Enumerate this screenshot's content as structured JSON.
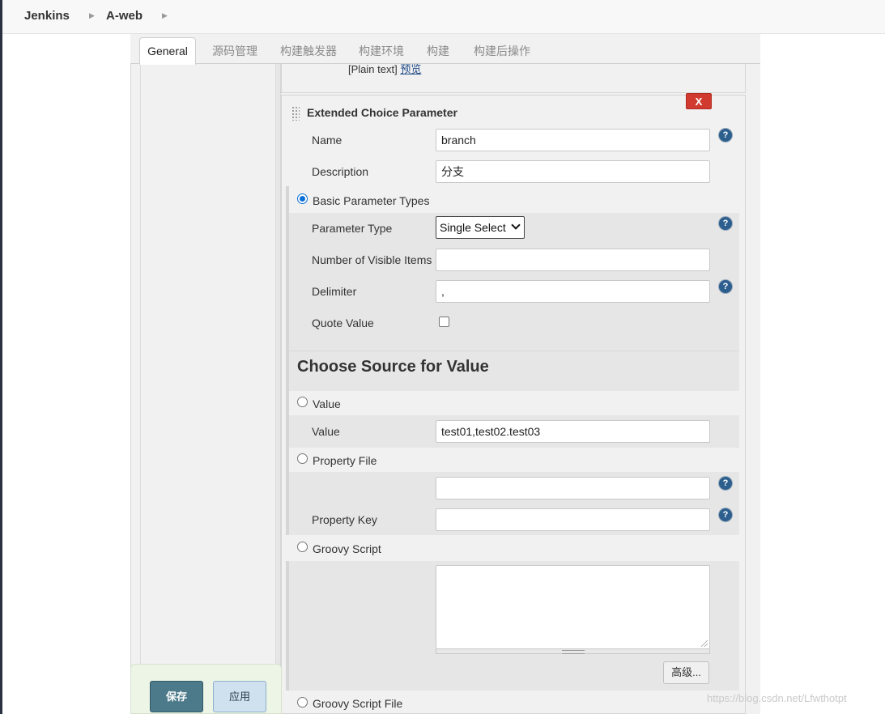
{
  "breadcrumb": {
    "items": [
      "Jenkins",
      "A-web"
    ]
  },
  "tabs": [
    {
      "label": "General",
      "active": true
    },
    {
      "label": "源码管理"
    },
    {
      "label": "构建触发器"
    },
    {
      "label": "构建环境"
    },
    {
      "label": "构建"
    },
    {
      "label": "构建后操作"
    }
  ],
  "prev_block": {
    "text": "[Plain text]",
    "preview_link": "预览"
  },
  "extended_choice": {
    "title": "Extended Choice Parameter",
    "delete_label": "X",
    "name_label": "Name",
    "name_value": "branch",
    "description_label": "Description",
    "description_value": "分支",
    "basic_types_label": "Basic Parameter Types",
    "parameter_type_label": "Parameter Type",
    "parameter_type_value": "Single Select",
    "visible_items_label": "Number of Visible Items",
    "visible_items_value": "",
    "delimiter_label": "Delimiter",
    "delimiter_value": ",",
    "quote_value_label": "Quote Value",
    "choose_source_title": "Choose Source for Value",
    "value_radio_label": "Value",
    "value_label": "Value",
    "value_value": "test01,test02.test03",
    "property_file_label": "Property File",
    "property_file_value": "",
    "property_key_label": "Property Key",
    "property_key_value": "",
    "groovy_script_label": "Groovy Script",
    "advanced_label": "高级...",
    "groovy_script_file_label": "Groovy Script File"
  },
  "help_symbol": "?",
  "bottom": {
    "save_label": "保存",
    "apply_label": "应用"
  },
  "watermark": "https://blog.csdn.net/Lfwthotpt",
  "colors": {
    "save_button": "#4c7a8a",
    "apply_button": "#cfe0ef",
    "delete_button": "#d13a2e",
    "help_icon": "#2c5f8e",
    "radio_checked": "#0b6fd8"
  }
}
